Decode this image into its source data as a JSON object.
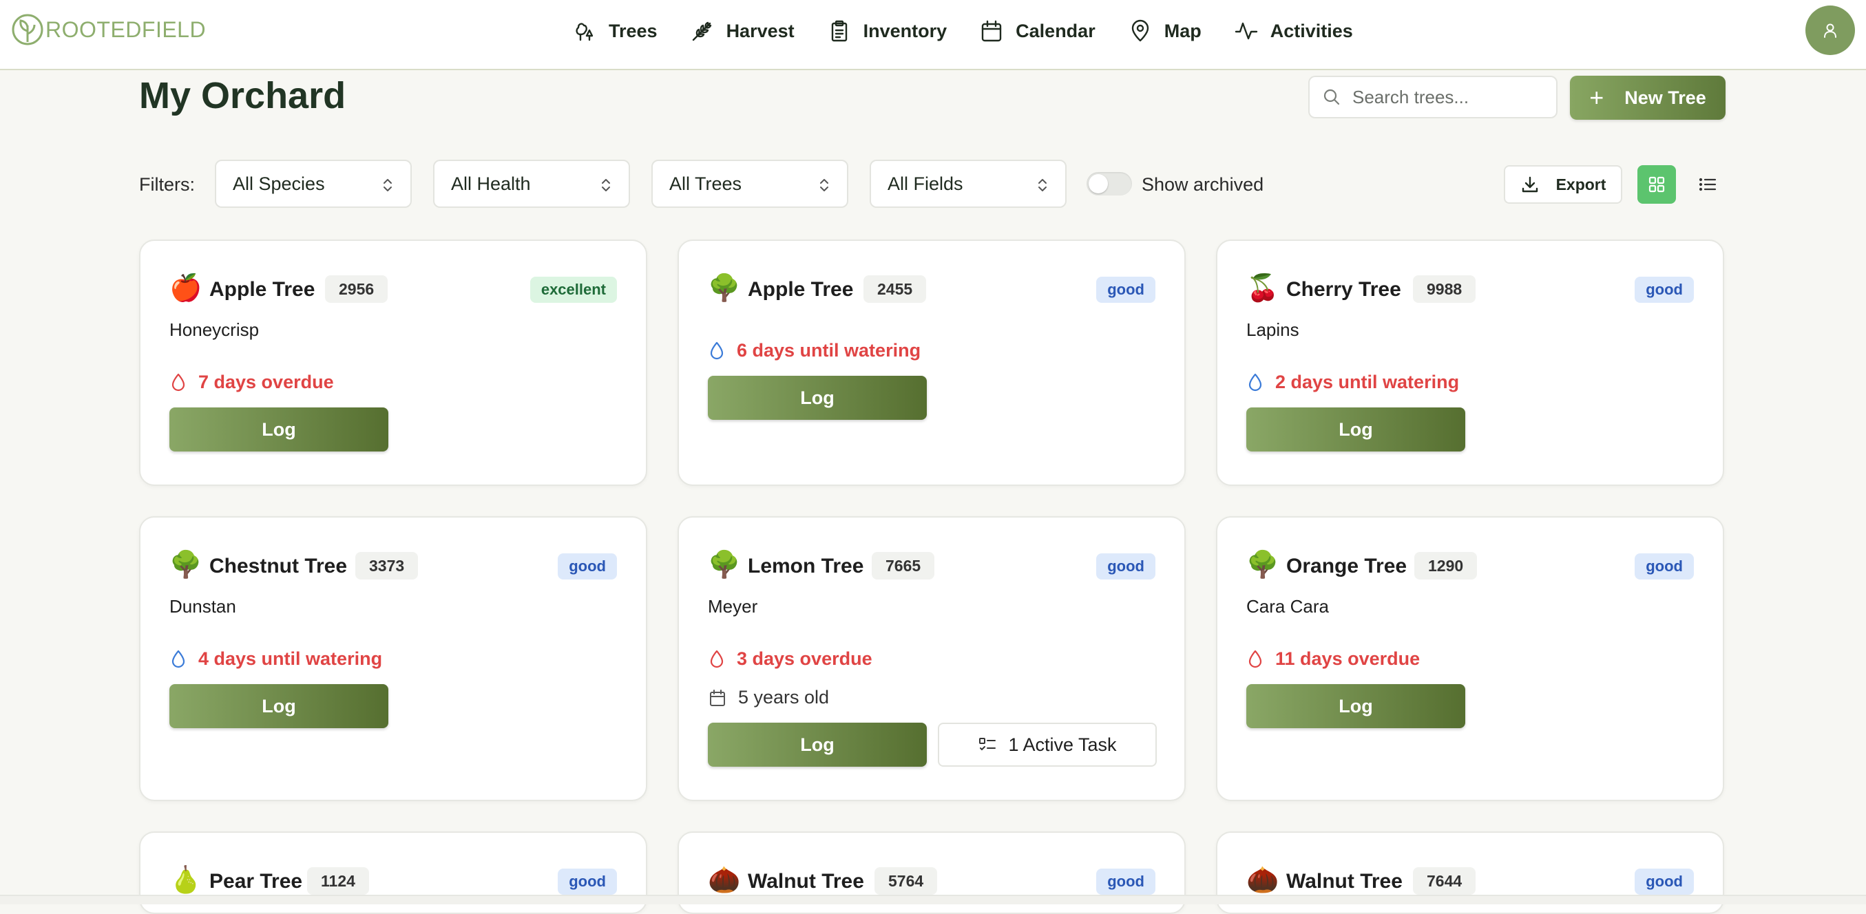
{
  "brand": {
    "logo_text": "ROOTEDFIELD"
  },
  "nav": {
    "items": [
      {
        "label": "Trees",
        "icon": "trees-icon"
      },
      {
        "label": "Harvest",
        "icon": "wheat-icon"
      },
      {
        "label": "Inventory",
        "icon": "clipboard-icon"
      },
      {
        "label": "Calendar",
        "icon": "calendar-icon"
      },
      {
        "label": "Map",
        "icon": "map-pin-icon"
      },
      {
        "label": "Activities",
        "icon": "activity-icon"
      }
    ]
  },
  "header": {
    "title": "My Orchard",
    "search_placeholder": "Search trees...",
    "new_button": "New Tree"
  },
  "filters": {
    "label": "Filters:",
    "selects": [
      "All Species",
      "All Health",
      "All Trees",
      "All Fields"
    ],
    "toggle_label": "Show archived",
    "toggle_on": false,
    "export_label": "Export",
    "view_mode": "grid"
  },
  "colors": {
    "accent": "#7f9c5f",
    "overdue": "#e04444",
    "view_active": "#5cc46e"
  },
  "cards": [
    {
      "emoji": "🍎",
      "name": "Apple Tree",
      "id": "2956",
      "health": "excellent",
      "variety": "Honeycrisp",
      "water_text": "7 days overdue",
      "water_status": "overdue",
      "age": "",
      "log_label": "Log",
      "task": ""
    },
    {
      "emoji": "🌳",
      "name": "Apple Tree",
      "id": "2455",
      "health": "good",
      "variety": "",
      "water_text": "6 days until watering",
      "water_status": "upcoming",
      "age": "",
      "log_label": "Log",
      "task": ""
    },
    {
      "emoji": "🍒",
      "name": "Cherry Tree",
      "id": "9988",
      "health": "good",
      "variety": "Lapins",
      "water_text": "2 days until watering",
      "water_status": "upcoming",
      "age": "",
      "log_label": "Log",
      "task": ""
    },
    {
      "emoji": "🌳",
      "name": "Chestnut Tree",
      "id": "3373",
      "health": "good",
      "variety": "Dunstan",
      "water_text": "4 days until watering",
      "water_status": "upcoming",
      "age": "",
      "log_label": "Log",
      "task": ""
    },
    {
      "emoji": "🌳",
      "name": "Lemon Tree",
      "id": "7665",
      "health": "good",
      "variety": "Meyer",
      "water_text": "3 days overdue",
      "water_status": "overdue",
      "age": "5 years old",
      "log_label": "Log",
      "task": "1 Active Task"
    },
    {
      "emoji": "🌳",
      "name": "Orange Tree",
      "id": "1290",
      "health": "good",
      "variety": "Cara Cara",
      "water_text": "11 days overdue",
      "water_status": "overdue",
      "age": "",
      "log_label": "Log",
      "task": ""
    },
    {
      "emoji": "🍐",
      "name": "Pear Tree",
      "id": "1124",
      "health": "good",
      "variety": "",
      "water_text": "",
      "water_status": "",
      "age": "",
      "log_label": "",
      "task": ""
    },
    {
      "emoji": "🌰",
      "name": "Walnut Tree",
      "id": "5764",
      "health": "good",
      "variety": "",
      "water_text": "",
      "water_status": "",
      "age": "",
      "log_label": "",
      "task": ""
    },
    {
      "emoji": "🌰",
      "name": "Walnut Tree",
      "id": "7644",
      "health": "good",
      "variety": "",
      "water_text": "",
      "water_status": "",
      "age": "",
      "log_label": "",
      "task": ""
    }
  ]
}
